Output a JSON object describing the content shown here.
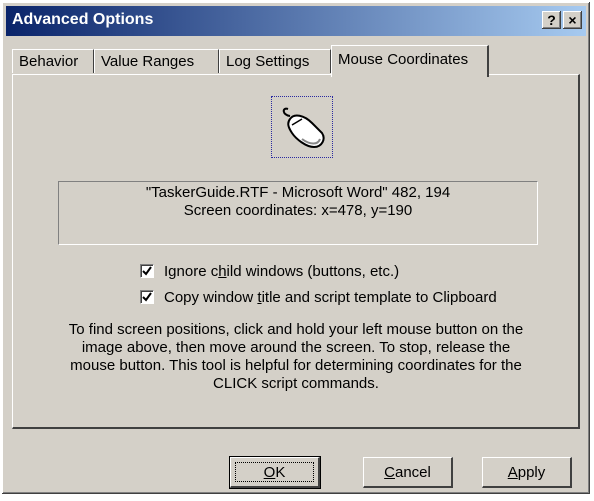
{
  "window": {
    "title": "Advanced Options",
    "help_glyph": "?",
    "close_glyph": "×"
  },
  "tabs": [
    {
      "label": "Behavior",
      "active": false
    },
    {
      "label": "Value Ranges",
      "active": false
    },
    {
      "label": "Log Settings",
      "active": false
    },
    {
      "label": "Mouse Coordinates",
      "active": true
    }
  ],
  "info": {
    "line1": "\"TaskerGuide.RTF - Microsoft Word\" 482, 194",
    "line2": "Screen coordinates: x=478, y=190"
  },
  "options": {
    "ignore_child": {
      "pre": "Ignore c",
      "accel": "h",
      "post": "ild windows (buttons, etc.)",
      "checked": true
    },
    "copy_title": {
      "pre": "Copy window ",
      "accel": "t",
      "post": "itle and script template to Clipboard",
      "checked": true
    }
  },
  "help": {
    "line1": "To find screen positions, click and hold your left mouse button on the",
    "line2": "image above, then move around the screen.  To stop, release the",
    "line3": "mouse button.  This tool is helpful for determining coordinates for the",
    "line4": "CLICK script commands."
  },
  "buttons": {
    "ok": {
      "accel": "O",
      "rest": "K"
    },
    "cancel": {
      "accel": "C",
      "rest": "ancel"
    },
    "apply": {
      "accel": "A",
      "rest": "pply"
    }
  },
  "icons": {
    "mouse": "mouse-icon",
    "check": "checkmark-icon"
  }
}
